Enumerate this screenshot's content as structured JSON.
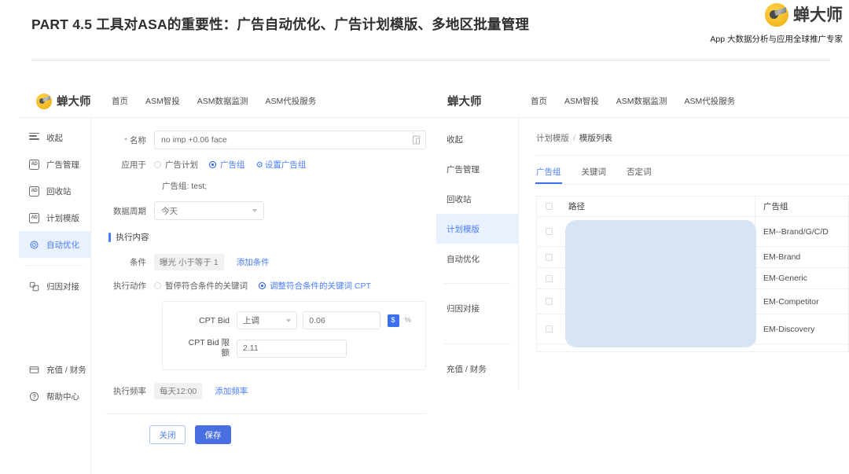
{
  "slide": {
    "title": "PART 4.5 工具对ASA的重要性：广告自动优化、广告计划模版、多地区批量管理",
    "brand_name": "蝉大师",
    "brand_tagline": "App 大数据分析与应用全球推广专家",
    "logo_icon": "cicada-logo-icon"
  },
  "left_app": {
    "logo_text": "蝉大师",
    "nav": [
      {
        "label": "首页"
      },
      {
        "label": "ASM智投"
      },
      {
        "label": "ASM数据监测"
      },
      {
        "label": "ASM代投服务"
      }
    ],
    "sidebar": [
      {
        "label": "收起",
        "icon": "hamburger-icon",
        "active": false
      },
      {
        "label": "广告管理",
        "icon": "ad-box-icon",
        "active": false
      },
      {
        "label": "回收站",
        "icon": "ad-box-icon",
        "active": false
      },
      {
        "label": "计划模版",
        "icon": "ad-box-icon",
        "active": false
      },
      {
        "label": "自动优化",
        "icon": "gear-icon",
        "active": true
      },
      {
        "label": "归因对接",
        "icon": "link-icon",
        "active": false
      },
      {
        "label": "充值 / 财务",
        "icon": "card-icon",
        "active": false
      },
      {
        "label": "帮助中心",
        "icon": "help-icon",
        "active": false
      }
    ],
    "form": {
      "name_label": "名称",
      "name_required_mark": "*",
      "name_value": "no imp +0.06 face",
      "name_tail_icon": "copy-icon",
      "apply_label": "应用于",
      "apply_options": [
        {
          "label": "广告计划",
          "selected": false
        },
        {
          "label": "广告组",
          "selected": true
        }
      ],
      "apply_link": "设置广告组",
      "apply_link_icon": "gear-small-icon",
      "apply_note": "广告组: test;",
      "period_label": "数据周期",
      "period_value": "今天",
      "section_title": "执行内容",
      "condition_label": "条件",
      "condition_value": "曝光 小于等于 1",
      "condition_add_link": "添加条件",
      "action_label": "执行动作",
      "action_options": [
        {
          "label": "暂停符合条件的关键词",
          "selected": false
        },
        {
          "label": "调整符合条件的关键词 CPT",
          "selected": true
        }
      ],
      "cpt_bid_label": "CPT Bid",
      "cpt_bid_direction": "上调",
      "cpt_bid_amount": "0.06",
      "cpt_units": [
        {
          "label": "$",
          "selected": true
        },
        {
          "label": "%",
          "selected": false
        }
      ],
      "cpt_limit_label": "CPT Bid 限额",
      "cpt_limit_label_line1": "CPT Bid 限",
      "cpt_limit_label_line2": "额",
      "cpt_limit_value": "2.11",
      "freq_label": "执行频率",
      "freq_value": "每天12:00",
      "freq_add_link": "添加频率",
      "close_button": "关闭",
      "save_button": "保存"
    }
  },
  "right_app": {
    "logo_text": "蝉大师",
    "nav": [
      {
        "label": "首页"
      },
      {
        "label": "ASM智投"
      },
      {
        "label": "ASM数据监测"
      },
      {
        "label": "ASM代投服务"
      }
    ],
    "sidebar": [
      {
        "label": "收起",
        "icon": "hamburger-icon",
        "active": false
      },
      {
        "label": "广告管理",
        "icon": "ad-box-icon",
        "active": false
      },
      {
        "label": "回收站",
        "icon": "ad-box-icon",
        "active": false
      },
      {
        "label": "计划模版",
        "icon": "ad-box-icon",
        "active": true
      },
      {
        "label": "自动优化",
        "icon": "gear-icon",
        "active": false
      },
      {
        "label": "归因对接",
        "icon": "link-icon",
        "active": false
      },
      {
        "label": "充值 / 财务",
        "icon": "card-icon",
        "active": false
      }
    ],
    "breadcrumb": {
      "parent": "计划模版",
      "separator": "/",
      "current": "模版列表"
    },
    "tabs": [
      {
        "label": "广告组",
        "active": true
      },
      {
        "label": "关键词",
        "active": false
      },
      {
        "label": "否定词",
        "active": false
      }
    ],
    "table": {
      "columns": [
        "路径",
        "广告组"
      ],
      "rows": [
        {
          "path": "",
          "group": "EM--Brand/G/C/D"
        },
        {
          "path": "",
          "group": "EM-Brand"
        },
        {
          "path": "",
          "group": "EM-Generic"
        },
        {
          "path": "",
          "group": "EM-Competitor"
        },
        {
          "path": "",
          "group": "EM-Discovery"
        }
      ],
      "redaction_note": "path-column-redacted"
    }
  },
  "colors": {
    "accent_blue": "#4a7dfc",
    "primary_button": "#4a6fe0",
    "active_nav_bg": "#eaf1fe",
    "brand_yellow": "#f2b91f",
    "redaction": "#d6e4f3"
  }
}
